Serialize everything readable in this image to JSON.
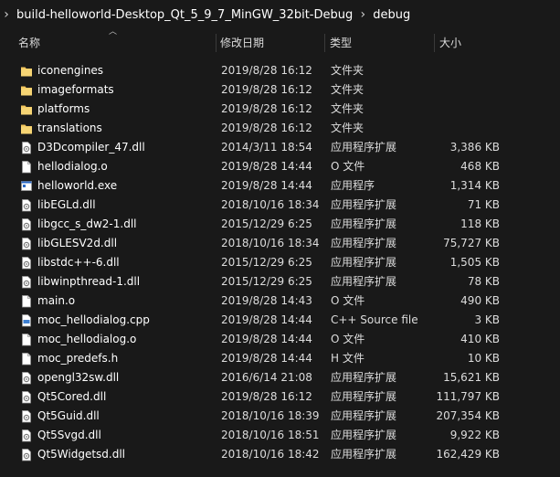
{
  "breadcrumb": {
    "items": [
      "build-helloworld-Desktop_Qt_5_9_7_MinGW_32bit-Debug",
      "debug"
    ]
  },
  "columns": {
    "name": "名称",
    "date": "修改日期",
    "type": "类型",
    "size": "大小"
  },
  "files": [
    {
      "name": "iconengines",
      "date": "2019/8/28 16:12",
      "type": "文件夹",
      "size": "",
      "icon": "folder-icon"
    },
    {
      "name": "imageformats",
      "date": "2019/8/28 16:12",
      "type": "文件夹",
      "size": "",
      "icon": "folder-icon"
    },
    {
      "name": "platforms",
      "date": "2019/8/28 16:12",
      "type": "文件夹",
      "size": "",
      "icon": "folder-icon"
    },
    {
      "name": "translations",
      "date": "2019/8/28 16:12",
      "type": "文件夹",
      "size": "",
      "icon": "folder-icon"
    },
    {
      "name": "D3Dcompiler_47.dll",
      "date": "2014/3/11 18:54",
      "type": "应用程序扩展",
      "size": "3,386 KB",
      "icon": "dll-icon"
    },
    {
      "name": "hellodialog.o",
      "date": "2019/8/28 14:44",
      "type": "O 文件",
      "size": "468 KB",
      "icon": "file-icon"
    },
    {
      "name": "helloworld.exe",
      "date": "2019/8/28 14:44",
      "type": "应用程序",
      "size": "1,314 KB",
      "icon": "exe-icon"
    },
    {
      "name": "libEGLd.dll",
      "date": "2018/10/16 18:34",
      "type": "应用程序扩展",
      "size": "71 KB",
      "icon": "dll-icon"
    },
    {
      "name": "libgcc_s_dw2-1.dll",
      "date": "2015/12/29 6:25",
      "type": "应用程序扩展",
      "size": "118 KB",
      "icon": "dll-icon"
    },
    {
      "name": "libGLESV2d.dll",
      "date": "2018/10/16 18:34",
      "type": "应用程序扩展",
      "size": "75,727 KB",
      "icon": "dll-icon"
    },
    {
      "name": "libstdc++-6.dll",
      "date": "2015/12/29 6:25",
      "type": "应用程序扩展",
      "size": "1,505 KB",
      "icon": "dll-icon"
    },
    {
      "name": "libwinpthread-1.dll",
      "date": "2015/12/29 6:25",
      "type": "应用程序扩展",
      "size": "78 KB",
      "icon": "dll-icon"
    },
    {
      "name": "main.o",
      "date": "2019/8/28 14:43",
      "type": "O 文件",
      "size": "490 KB",
      "icon": "file-icon"
    },
    {
      "name": "moc_hellodialog.cpp",
      "date": "2019/8/28 14:44",
      "type": "C++ Source file",
      "size": "3 KB",
      "icon": "cpp-icon"
    },
    {
      "name": "moc_hellodialog.o",
      "date": "2019/8/28 14:44",
      "type": "O 文件",
      "size": "410 KB",
      "icon": "file-icon"
    },
    {
      "name": "moc_predefs.h",
      "date": "2019/8/28 14:44",
      "type": "H 文件",
      "size": "10 KB",
      "icon": "file-icon"
    },
    {
      "name": "opengl32sw.dll",
      "date": "2016/6/14 21:08",
      "type": "应用程序扩展",
      "size": "15,621 KB",
      "icon": "dll-icon"
    },
    {
      "name": "Qt5Cored.dll",
      "date": "2019/8/28 16:12",
      "type": "应用程序扩展",
      "size": "111,797 KB",
      "icon": "dll-icon"
    },
    {
      "name": "Qt5Guid.dll",
      "date": "2018/10/16 18:39",
      "type": "应用程序扩展",
      "size": "207,354 KB",
      "icon": "dll-icon"
    },
    {
      "name": "Qt5Svgd.dll",
      "date": "2018/10/16 18:51",
      "type": "应用程序扩展",
      "size": "9,922 KB",
      "icon": "dll-icon"
    },
    {
      "name": "Qt5Widgetsd.dll",
      "date": "2018/10/16 18:42",
      "type": "应用程序扩展",
      "size": "162,429 KB",
      "icon": "dll-icon"
    }
  ],
  "colors": {
    "background": "#191919",
    "folder": "#f2c55c",
    "text": "#ffffff"
  }
}
